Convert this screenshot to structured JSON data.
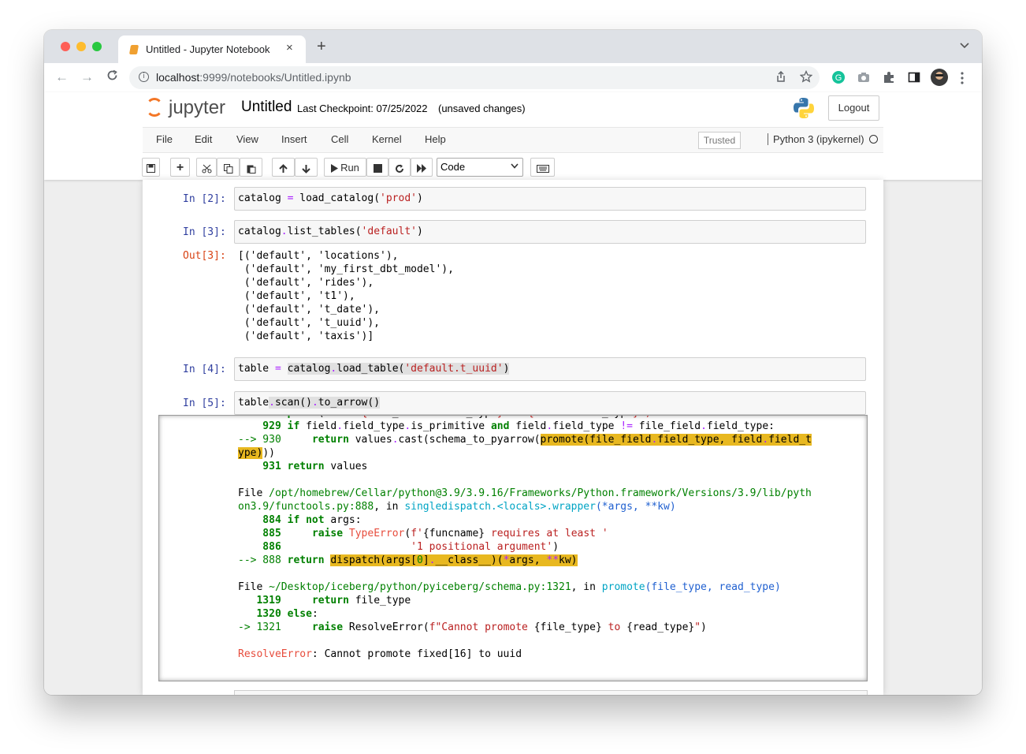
{
  "browser": {
    "tab_title": "Untitled - Jupyter Notebook",
    "tab_close": "×",
    "new_tab": "+",
    "tab_menu": "⌄",
    "url_host": "localhost",
    "url_path": ":9999/notebooks/Untitled.ipynb",
    "back": "←",
    "forward": "→",
    "reload": "C"
  },
  "jupyter": {
    "logo_text": "jupyter",
    "notebook_name": "Untitled",
    "checkpoint": "Last Checkpoint: 07/25/2022",
    "unsaved": "(unsaved changes)",
    "logout": "Logout",
    "menu": [
      "File",
      "Edit",
      "View",
      "Insert",
      "Cell",
      "Kernel",
      "Help"
    ],
    "trusted": "Trusted",
    "kernel": "Python 3 (ipykernel)",
    "run_label": "Run",
    "cell_type": "Code"
  },
  "cells": {
    "c2_prompt": "In [2]:",
    "c3_prompt": "In [3]:",
    "out3_prompt": "Out[3]:",
    "c4_prompt": "In [4]:",
    "c5_prompt": "In [5]:",
    "out3_lines": [
      "[('default', 'locations'),",
      " ('default', 'my_first_dbt_model'),",
      " ('default', 'rides'),",
      " ('default', 't1'),",
      " ('default', 't_date'),",
      " ('default', 't_uuid'),",
      " ('default', 'taxis')]"
    ]
  },
  "traceback": {
    "file2_label": "File",
    "file2_path": "/opt/homebrew/Cellar/python@3.9/3.9.16/Frameworks/Python.framework/Versions/3.9/lib/pyth",
    "file2_path2": "on3.9/functools.py:888",
    "file3_path": "~/Desktop/iceberg/python/pyiceberg/schema.py:1321",
    "error_name": "ResolveError",
    "error_msg": ": Cannot promote fixed[16] to uuid"
  }
}
